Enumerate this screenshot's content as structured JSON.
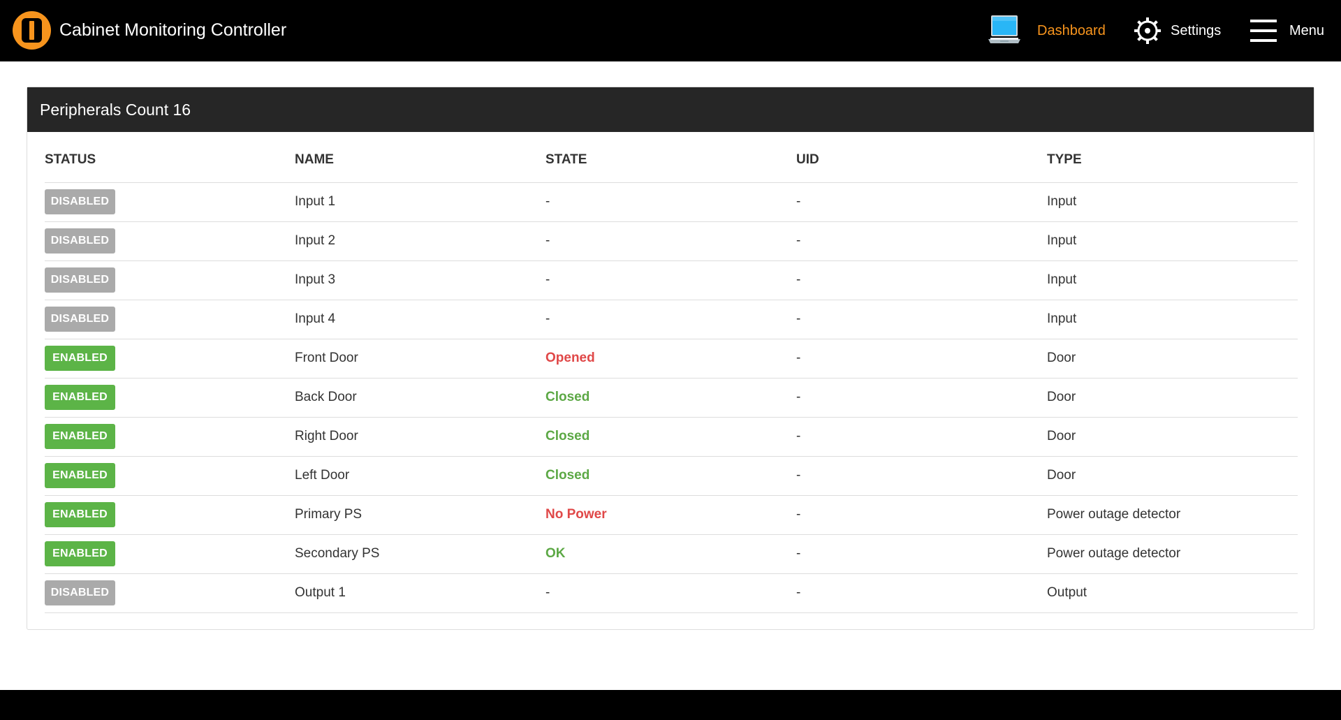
{
  "app": {
    "title": "Cabinet Monitoring Controller"
  },
  "nav": {
    "dashboard": "Dashboard",
    "settings": "Settings",
    "menu": "Menu"
  },
  "colors": {
    "accent": "#f7941d",
    "enabled": "#5cb447",
    "disabled": "#aaaaaa",
    "state_alert": "#e04848",
    "state_ok": "#5ca845"
  },
  "panel": {
    "title": "Peripherals Count 16"
  },
  "table": {
    "headers": {
      "status": "STATUS",
      "name": "NAME",
      "state": "STATE",
      "uid": "UID",
      "type": "TYPE"
    },
    "rows": [
      {
        "status": "DISABLED",
        "name": "Input 1",
        "state": "-",
        "state_tone": "plain",
        "uid": "-",
        "type": "Input"
      },
      {
        "status": "DISABLED",
        "name": "Input 2",
        "state": "-",
        "state_tone": "plain",
        "uid": "-",
        "type": "Input"
      },
      {
        "status": "DISABLED",
        "name": "Input 3",
        "state": "-",
        "state_tone": "plain",
        "uid": "-",
        "type": "Input"
      },
      {
        "status": "DISABLED",
        "name": "Input 4",
        "state": "-",
        "state_tone": "plain",
        "uid": "-",
        "type": "Input"
      },
      {
        "status": "ENABLED",
        "name": "Front Door",
        "state": "Opened",
        "state_tone": "alert",
        "uid": "-",
        "type": "Door"
      },
      {
        "status": "ENABLED",
        "name": "Back Door",
        "state": "Closed",
        "state_tone": "ok",
        "uid": "-",
        "type": "Door"
      },
      {
        "status": "ENABLED",
        "name": "Right Door",
        "state": "Closed",
        "state_tone": "ok",
        "uid": "-",
        "type": "Door"
      },
      {
        "status": "ENABLED",
        "name": "Left Door",
        "state": "Closed",
        "state_tone": "ok",
        "uid": "-",
        "type": "Door"
      },
      {
        "status": "ENABLED",
        "name": "Primary PS",
        "state": "No Power",
        "state_tone": "alert",
        "uid": "-",
        "type": "Power outage detector"
      },
      {
        "status": "ENABLED",
        "name": "Secondary PS",
        "state": "OK",
        "state_tone": "ok",
        "uid": "-",
        "type": "Power outage detector"
      },
      {
        "status": "DISABLED",
        "name": "Output 1",
        "state": "-",
        "state_tone": "plain",
        "uid": "-",
        "type": "Output"
      }
    ]
  }
}
